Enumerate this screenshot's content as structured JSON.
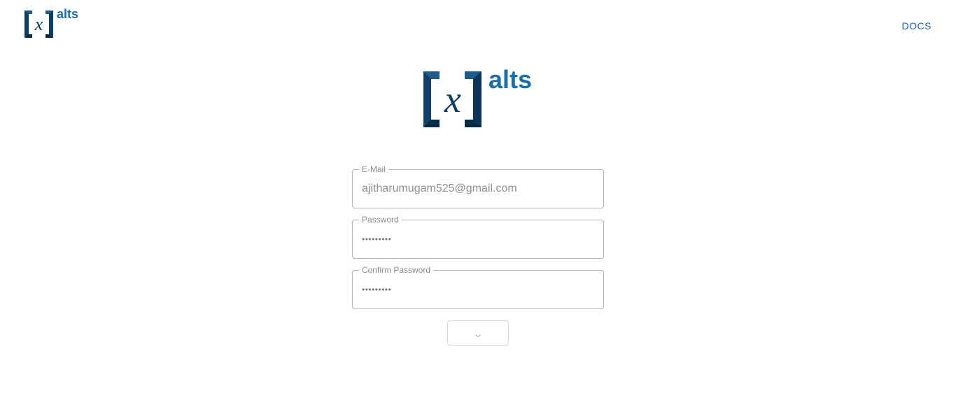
{
  "header": {
    "logo_text": "alts",
    "logo_glyph": "x",
    "docs_link": "DOCS"
  },
  "hero": {
    "logo_text": "alts",
    "logo_glyph": "x"
  },
  "form": {
    "email": {
      "label": "E-Mail",
      "value": "ajitharumugam525@gmail.com"
    },
    "password": {
      "label": "Password",
      "value": "•••••••••"
    },
    "confirm_password": {
      "label": "Confirm Password",
      "value": "•••••••••"
    },
    "submit": {
      "icon": "spinner-icon"
    }
  },
  "colors": {
    "brand_dark": "#0d3d66",
    "brand_mid": "#17679a",
    "brand_text": "#1a6ea8",
    "link": "#1f5fbf"
  }
}
